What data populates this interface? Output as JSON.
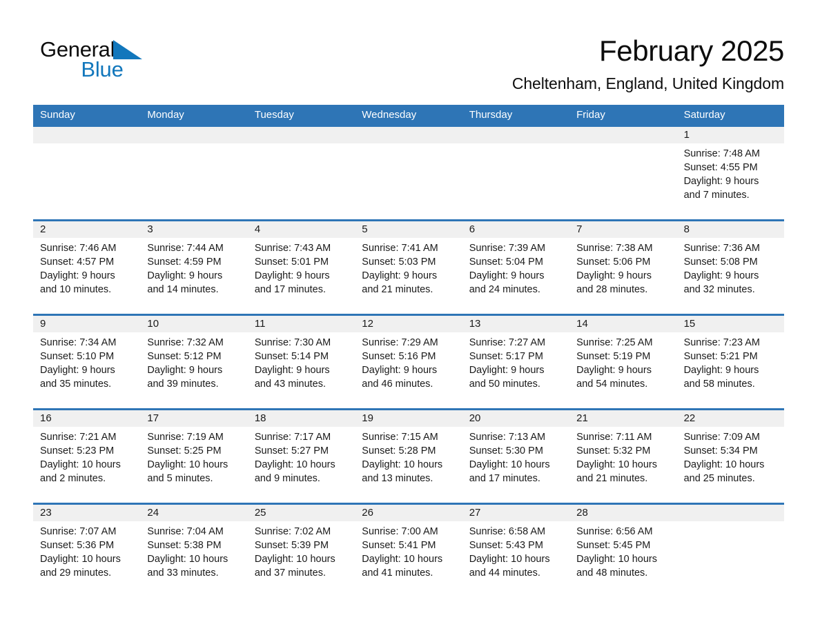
{
  "brand": {
    "name_part1": "General",
    "name_part2": "Blue",
    "triangle_color": "#1277bc"
  },
  "header": {
    "title": "February 2025",
    "subtitle": "Cheltenham, England, United Kingdom"
  },
  "colors": {
    "header_blue": "#2e75b6",
    "date_band_gray": "#f0f0f0",
    "text": "#1a1a1a",
    "header_text": "#ffffff"
  },
  "weekday_headers": [
    "Sunday",
    "Monday",
    "Tuesday",
    "Wednesday",
    "Thursday",
    "Friday",
    "Saturday"
  ],
  "labels": {
    "sunrise_prefix": "Sunrise:",
    "sunset_prefix": "Sunset:",
    "daylight_prefix": "Daylight:"
  },
  "weeks": [
    [
      {
        "day": "",
        "sunrise": "",
        "sunset": "",
        "daylight_line1": "",
        "daylight_line2": ""
      },
      {
        "day": "",
        "sunrise": "",
        "sunset": "",
        "daylight_line1": "",
        "daylight_line2": ""
      },
      {
        "day": "",
        "sunrise": "",
        "sunset": "",
        "daylight_line1": "",
        "daylight_line2": ""
      },
      {
        "day": "",
        "sunrise": "",
        "sunset": "",
        "daylight_line1": "",
        "daylight_line2": ""
      },
      {
        "day": "",
        "sunrise": "",
        "sunset": "",
        "daylight_line1": "",
        "daylight_line2": ""
      },
      {
        "day": "",
        "sunrise": "",
        "sunset": "",
        "daylight_line1": "",
        "daylight_line2": ""
      },
      {
        "day": "1",
        "sunrise": "Sunrise: 7:48 AM",
        "sunset": "Sunset: 4:55 PM",
        "daylight_line1": "Daylight: 9 hours",
        "daylight_line2": "and 7 minutes."
      }
    ],
    [
      {
        "day": "2",
        "sunrise": "Sunrise: 7:46 AM",
        "sunset": "Sunset: 4:57 PM",
        "daylight_line1": "Daylight: 9 hours",
        "daylight_line2": "and 10 minutes."
      },
      {
        "day": "3",
        "sunrise": "Sunrise: 7:44 AM",
        "sunset": "Sunset: 4:59 PM",
        "daylight_line1": "Daylight: 9 hours",
        "daylight_line2": "and 14 minutes."
      },
      {
        "day": "4",
        "sunrise": "Sunrise: 7:43 AM",
        "sunset": "Sunset: 5:01 PM",
        "daylight_line1": "Daylight: 9 hours",
        "daylight_line2": "and 17 minutes."
      },
      {
        "day": "5",
        "sunrise": "Sunrise: 7:41 AM",
        "sunset": "Sunset: 5:03 PM",
        "daylight_line1": "Daylight: 9 hours",
        "daylight_line2": "and 21 minutes."
      },
      {
        "day": "6",
        "sunrise": "Sunrise: 7:39 AM",
        "sunset": "Sunset: 5:04 PM",
        "daylight_line1": "Daylight: 9 hours",
        "daylight_line2": "and 24 minutes."
      },
      {
        "day": "7",
        "sunrise": "Sunrise: 7:38 AM",
        "sunset": "Sunset: 5:06 PM",
        "daylight_line1": "Daylight: 9 hours",
        "daylight_line2": "and 28 minutes."
      },
      {
        "day": "8",
        "sunrise": "Sunrise: 7:36 AM",
        "sunset": "Sunset: 5:08 PM",
        "daylight_line1": "Daylight: 9 hours",
        "daylight_line2": "and 32 minutes."
      }
    ],
    [
      {
        "day": "9",
        "sunrise": "Sunrise: 7:34 AM",
        "sunset": "Sunset: 5:10 PM",
        "daylight_line1": "Daylight: 9 hours",
        "daylight_line2": "and 35 minutes."
      },
      {
        "day": "10",
        "sunrise": "Sunrise: 7:32 AM",
        "sunset": "Sunset: 5:12 PM",
        "daylight_line1": "Daylight: 9 hours",
        "daylight_line2": "and 39 minutes."
      },
      {
        "day": "11",
        "sunrise": "Sunrise: 7:30 AM",
        "sunset": "Sunset: 5:14 PM",
        "daylight_line1": "Daylight: 9 hours",
        "daylight_line2": "and 43 minutes."
      },
      {
        "day": "12",
        "sunrise": "Sunrise: 7:29 AM",
        "sunset": "Sunset: 5:16 PM",
        "daylight_line1": "Daylight: 9 hours",
        "daylight_line2": "and 46 minutes."
      },
      {
        "day": "13",
        "sunrise": "Sunrise: 7:27 AM",
        "sunset": "Sunset: 5:17 PM",
        "daylight_line1": "Daylight: 9 hours",
        "daylight_line2": "and 50 minutes."
      },
      {
        "day": "14",
        "sunrise": "Sunrise: 7:25 AM",
        "sunset": "Sunset: 5:19 PM",
        "daylight_line1": "Daylight: 9 hours",
        "daylight_line2": "and 54 minutes."
      },
      {
        "day": "15",
        "sunrise": "Sunrise: 7:23 AM",
        "sunset": "Sunset: 5:21 PM",
        "daylight_line1": "Daylight: 9 hours",
        "daylight_line2": "and 58 minutes."
      }
    ],
    [
      {
        "day": "16",
        "sunrise": "Sunrise: 7:21 AM",
        "sunset": "Sunset: 5:23 PM",
        "daylight_line1": "Daylight: 10 hours",
        "daylight_line2": "and 2 minutes."
      },
      {
        "day": "17",
        "sunrise": "Sunrise: 7:19 AM",
        "sunset": "Sunset: 5:25 PM",
        "daylight_line1": "Daylight: 10 hours",
        "daylight_line2": "and 5 minutes."
      },
      {
        "day": "18",
        "sunrise": "Sunrise: 7:17 AM",
        "sunset": "Sunset: 5:27 PM",
        "daylight_line1": "Daylight: 10 hours",
        "daylight_line2": "and 9 minutes."
      },
      {
        "day": "19",
        "sunrise": "Sunrise: 7:15 AM",
        "sunset": "Sunset: 5:28 PM",
        "daylight_line1": "Daylight: 10 hours",
        "daylight_line2": "and 13 minutes."
      },
      {
        "day": "20",
        "sunrise": "Sunrise: 7:13 AM",
        "sunset": "Sunset: 5:30 PM",
        "daylight_line1": "Daylight: 10 hours",
        "daylight_line2": "and 17 minutes."
      },
      {
        "day": "21",
        "sunrise": "Sunrise: 7:11 AM",
        "sunset": "Sunset: 5:32 PM",
        "daylight_line1": "Daylight: 10 hours",
        "daylight_line2": "and 21 minutes."
      },
      {
        "day": "22",
        "sunrise": "Sunrise: 7:09 AM",
        "sunset": "Sunset: 5:34 PM",
        "daylight_line1": "Daylight: 10 hours",
        "daylight_line2": "and 25 minutes."
      }
    ],
    [
      {
        "day": "23",
        "sunrise": "Sunrise: 7:07 AM",
        "sunset": "Sunset: 5:36 PM",
        "daylight_line1": "Daylight: 10 hours",
        "daylight_line2": "and 29 minutes."
      },
      {
        "day": "24",
        "sunrise": "Sunrise: 7:04 AM",
        "sunset": "Sunset: 5:38 PM",
        "daylight_line1": "Daylight: 10 hours",
        "daylight_line2": "and 33 minutes."
      },
      {
        "day": "25",
        "sunrise": "Sunrise: 7:02 AM",
        "sunset": "Sunset: 5:39 PM",
        "daylight_line1": "Daylight: 10 hours",
        "daylight_line2": "and 37 minutes."
      },
      {
        "day": "26",
        "sunrise": "Sunrise: 7:00 AM",
        "sunset": "Sunset: 5:41 PM",
        "daylight_line1": "Daylight: 10 hours",
        "daylight_line2": "and 41 minutes."
      },
      {
        "day": "27",
        "sunrise": "Sunrise: 6:58 AM",
        "sunset": "Sunset: 5:43 PM",
        "daylight_line1": "Daylight: 10 hours",
        "daylight_line2": "and 44 minutes."
      },
      {
        "day": "28",
        "sunrise": "Sunrise: 6:56 AM",
        "sunset": "Sunset: 5:45 PM",
        "daylight_line1": "Daylight: 10 hours",
        "daylight_line2": "and 48 minutes."
      },
      {
        "day": "",
        "sunrise": "",
        "sunset": "",
        "daylight_line1": "",
        "daylight_line2": ""
      }
    ]
  ]
}
